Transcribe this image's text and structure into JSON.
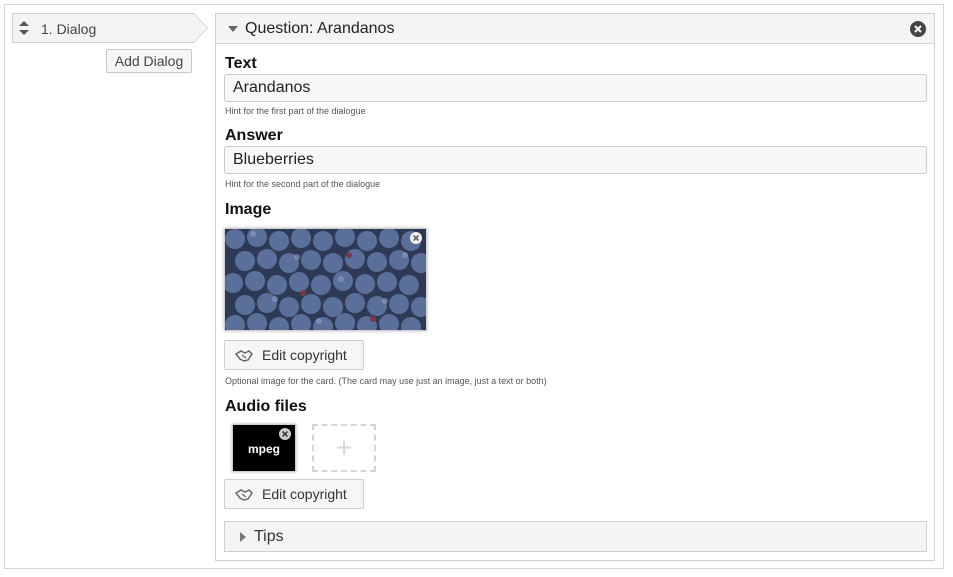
{
  "sidebar": {
    "items": [
      {
        "label": "1. Dialog",
        "icon": "sort-icon"
      }
    ],
    "add_button_label": "Add Dialog"
  },
  "question": {
    "title": "Question: Arandanos",
    "text": {
      "label": "Text",
      "value": "Arandanos",
      "hint": "Hint for the first part of the dialogue"
    },
    "answer": {
      "label": "Answer",
      "value": "Blueberries",
      "hint": "Hint for the second part of the dialogue"
    },
    "image": {
      "label": "Image",
      "copyright_label": "Edit copyright",
      "hint": "Optional image for the card. (The card may use just an image, just a text or both)"
    },
    "audio": {
      "label": "Audio files",
      "file_label": "mpeg",
      "copyright_label": "Edit copyright",
      "add_symbol": "+"
    },
    "tips": {
      "label": "Tips"
    }
  }
}
